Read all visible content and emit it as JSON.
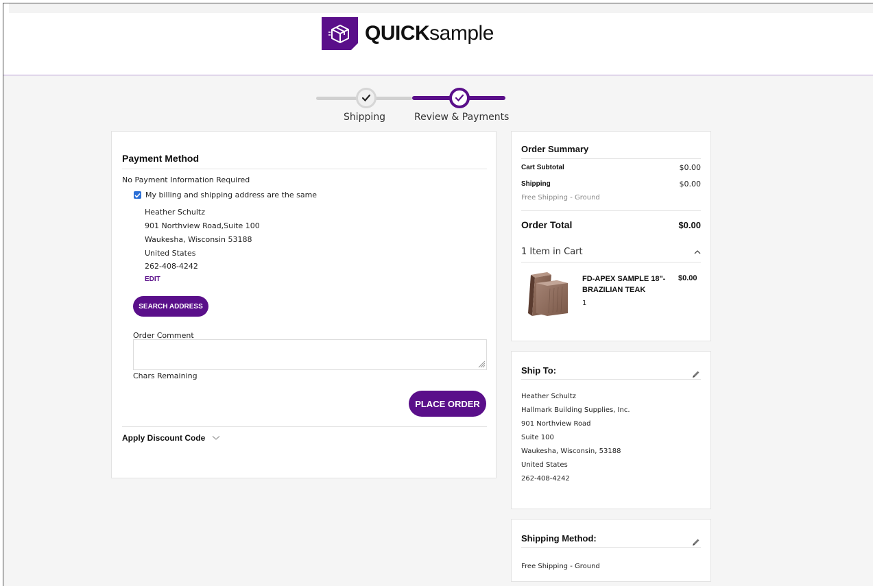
{
  "header": {
    "brand_bold": "QUICK",
    "brand_light": "sample"
  },
  "progress": {
    "steps": [
      {
        "label": "Shipping"
      },
      {
        "label": "Review & Payments"
      }
    ]
  },
  "payment": {
    "title": "Payment Method",
    "no_payment": "No Payment Information Required",
    "same_address_label": "My billing and shipping address are the same",
    "address": {
      "name": "Heather Schultz",
      "street": "901 Northview Road,Suite 100",
      "city": "Waukesha, Wisconsin 53188",
      "country": "United States",
      "phone": "262-408-4242"
    },
    "edit_label": "EDIT",
    "search_address_label": "SEARCH ADDRESS",
    "order_comment_label": "Order Comment",
    "chars_remaining_label": "Chars Remaining",
    "place_order_label": "PLACE ORDER",
    "discount_label": "Apply Discount Code"
  },
  "summary": {
    "title": "Order Summary",
    "subtotal_label": "Cart Subtotal",
    "subtotal_value": "$0.00",
    "shipping_label": "Shipping",
    "shipping_value": "$0.00",
    "shipping_method": "Free Shipping - Ground",
    "total_label": "Order Total",
    "total_value": "$0.00",
    "items_label": "1 Item in Cart",
    "item": {
      "name_line1": "FD-APEX SAMPLE 18\"-",
      "name_line2": "BRAZILIAN TEAK",
      "qty": "1",
      "price": "$0.00"
    }
  },
  "ship_to": {
    "title": "Ship To:",
    "lines": [
      "Heather Schultz",
      "Hallmark Building Supplies, Inc.",
      "901 Northview Road",
      "Suite 100",
      "Waukesha, Wisconsin, 53188",
      "United States",
      "262-408-4242"
    ]
  },
  "shipping_method": {
    "title": "Shipping Method:",
    "value": "Free Shipping - Ground"
  },
  "colors": {
    "brand": "#5a0f8a",
    "checkbox": "#2b6fd6"
  }
}
